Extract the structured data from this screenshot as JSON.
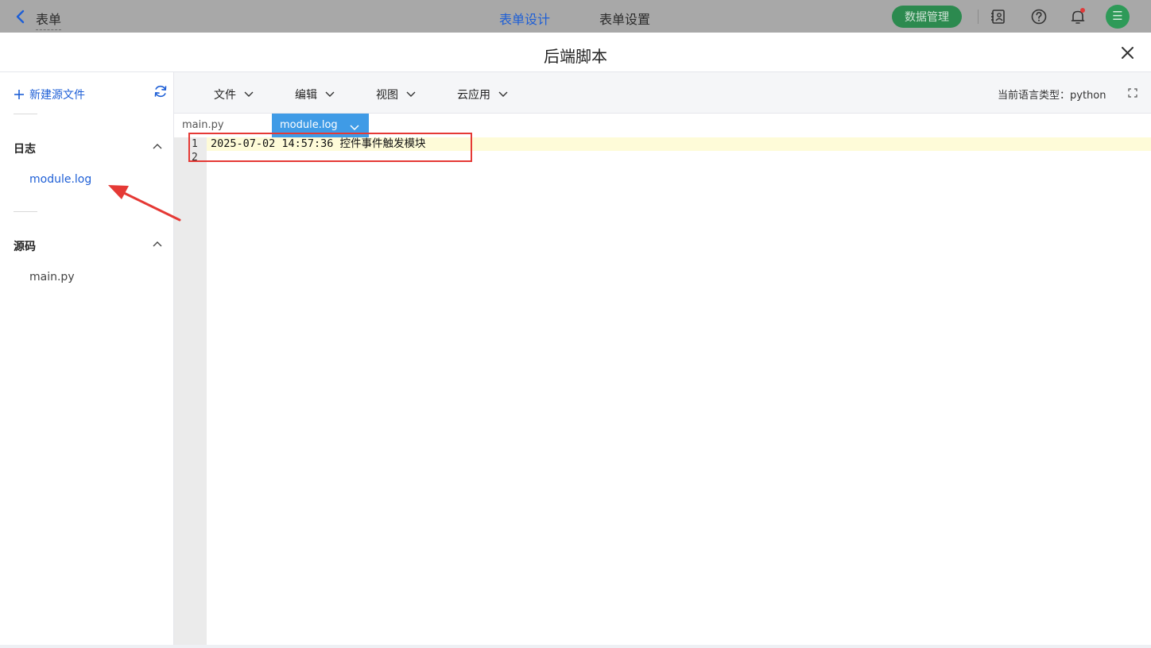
{
  "topbar": {
    "back_label": "表单",
    "tabs": [
      {
        "label": "表单设计",
        "active": true
      },
      {
        "label": "表单设置",
        "active": false
      }
    ],
    "data_manage_label": "数据管理",
    "avatar_label": "☰",
    "icons": [
      "contacts-icon",
      "help-icon",
      "bell-icon"
    ],
    "accent_color": "#1e5fd6",
    "button_color": "#2c8a4f"
  },
  "dialog": {
    "title": "后端脚本"
  },
  "sidebar": {
    "new_file_label": "新建源文件",
    "sections": [
      {
        "title": "日志",
        "items": [
          {
            "label": "module.log",
            "active": true
          }
        ]
      },
      {
        "title": "源码",
        "items": [
          {
            "label": "main.py",
            "active": false
          }
        ]
      }
    ]
  },
  "toolbar": {
    "menus": [
      {
        "label": "文件"
      },
      {
        "label": "编辑"
      },
      {
        "label": "视图"
      },
      {
        "label": "云应用"
      }
    ],
    "language_label": "当前语言类型：python"
  },
  "editor": {
    "tabs": [
      {
        "label": "main.py",
        "active": false
      },
      {
        "label": "module.log",
        "active": true
      }
    ],
    "line_numbers": [
      "1",
      "2"
    ],
    "lines": [
      "2025-07-02 14:57:36 控件事件触发模块",
      ""
    ]
  }
}
